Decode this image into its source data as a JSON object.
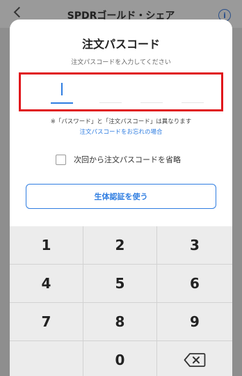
{
  "background": {
    "title": "SPDRゴールド・シェア",
    "info_icon": "info-icon",
    "info_symbol": "i"
  },
  "sheet": {
    "title": "注文パスコード",
    "subtitle": "注文パスコードを入力してください",
    "note": "※「パスワード」と「注文パスコード」は異なります",
    "forgot_link": "注文パスコードをお忘れの場合",
    "skip_label": "次回から注文パスコードを省略",
    "biometric_button": "生体認証を使う"
  },
  "keypad": {
    "keys": [
      "1",
      "2",
      "3",
      "4",
      "5",
      "6",
      "7",
      "8",
      "9",
      "",
      "0",
      "delete"
    ]
  },
  "colors": {
    "accent": "#2f7de1",
    "highlight_border": "#e0161b"
  }
}
